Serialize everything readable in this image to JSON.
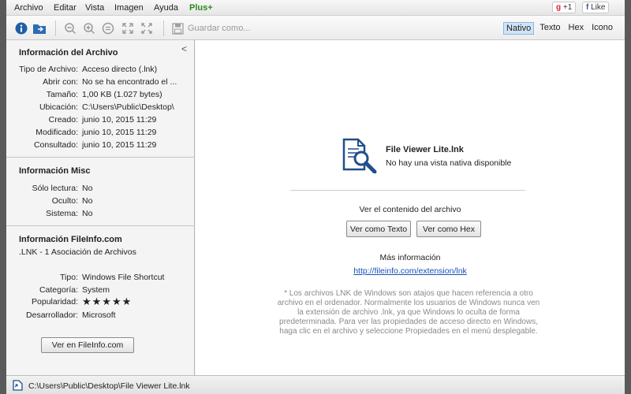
{
  "menubar": {
    "items": [
      "Archivo",
      "Editar",
      "Vista",
      "Imagen",
      "Ayuda"
    ],
    "plus": "Plus+",
    "gplus_count": "+1",
    "like_label": "Like"
  },
  "toolbar": {
    "save_label": "Guardar como...",
    "views": [
      "Nativo",
      "Texto",
      "Hex",
      "Icono"
    ],
    "active_view": "Nativo"
  },
  "left": {
    "collapse_glyph": "<",
    "file_section": {
      "title": "Información del Archivo",
      "rows": [
        {
          "k": "Tipo de Archivo:",
          "v": "Acceso directo (.lnk)"
        },
        {
          "k": "Abrir con:",
          "v": "No se ha encontrado el ..."
        },
        {
          "k": "Tamaño:",
          "v": "1,00 KB (1.027 bytes)"
        },
        {
          "k": "Ubicación:",
          "v": "C:\\Users\\Public\\Desktop\\"
        },
        {
          "k": "Creado:",
          "v": "junio 10, 2015 11:29"
        },
        {
          "k": "Modificado:",
          "v": "junio 10, 2015 11:29"
        },
        {
          "k": "Consultado:",
          "v": "junio 10, 2015 11:29"
        }
      ]
    },
    "misc_section": {
      "title": "Información Misc",
      "rows": [
        {
          "k": "Sólo lectura:",
          "v": "No"
        },
        {
          "k": "Oculto:",
          "v": "No"
        },
        {
          "k": "Sistema:",
          "v": "No"
        }
      ]
    },
    "fileinfo_section": {
      "title": "Información FileInfo.com",
      "subtitle": ".LNK - 1 Asociación de Archivos",
      "rows": [
        {
          "k": "Tipo:",
          "v": "Windows File Shortcut"
        },
        {
          "k": "Categoría:",
          "v": "System"
        },
        {
          "k": "Popularidad:",
          "v": "★★★★★"
        },
        {
          "k": "Desarrollador:",
          "v": "Microsoft"
        }
      ],
      "popularity_stars": 5,
      "button_label": "Ver en FileInfo.com"
    }
  },
  "main": {
    "file_name": "File Viewer Lite.lnk",
    "no_preview": "No hay una vista nativa disponible",
    "view_content_label": "Ver el contenido del archivo",
    "text_button": "Ver como Texto",
    "hex_button": "Ver como Hex",
    "more_info_label": "Más información",
    "more_info_link": "http://fileinfo.com/extension/lnk",
    "note": "* Los archivos LNK de Windows son atajos que hacen referencia a otro archivo en el ordenador. Normalmente los usuarios de Windows nunca ven la extensión de archivo .lnk, ya que Windows lo oculta de forma predeterminada. Para ver las propiedades de acceso directo en Windows, haga clic en el archivo y seleccione Propiedades en el menú desplegable."
  },
  "status": {
    "path": "C:\\Users\\Public\\Desktop\\File Viewer Lite.lnk"
  },
  "colors": {
    "accent": "#1f5fa8",
    "plus_green": "#2a8a1a",
    "link": "#1a4fb5",
    "active_view_bg": "#cfe3f7"
  }
}
